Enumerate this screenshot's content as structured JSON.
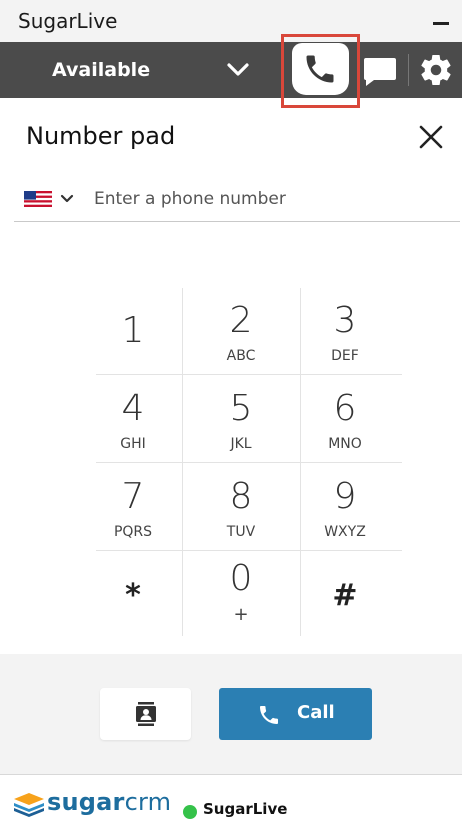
{
  "window": {
    "title": "SugarLive"
  },
  "toolbar": {
    "status": "Available",
    "active_tab": "phone"
  },
  "number_pad": {
    "title": "Number pad",
    "country_flag": "US",
    "phone_placeholder": "Enter a phone number",
    "phone_value": ""
  },
  "keys": [
    {
      "digit": "1",
      "letters": ""
    },
    {
      "digit": "2",
      "letters": "ABC"
    },
    {
      "digit": "3",
      "letters": "DEF"
    },
    {
      "digit": "4",
      "letters": "GHI"
    },
    {
      "digit": "5",
      "letters": "JKL"
    },
    {
      "digit": "6",
      "letters": "MNO"
    },
    {
      "digit": "7",
      "letters": "PQRS"
    },
    {
      "digit": "8",
      "letters": "TUV"
    },
    {
      "digit": "9",
      "letters": "WXYZ"
    },
    {
      "digit": "*",
      "letters": ""
    },
    {
      "digit": "0",
      "letters": "+"
    },
    {
      "digit": "#",
      "letters": ""
    }
  ],
  "actions": {
    "call_label": "Call"
  },
  "footer": {
    "brand_bold": "sugar",
    "brand_thin": "crm",
    "presence_label": "SugarLive"
  },
  "colors": {
    "toolbar_bg": "#4b4b4b",
    "active_tab_highlight": "#d9473a",
    "call_button": "#2b7fb3",
    "presence_online": "#35c24a",
    "brand_blue": "#1d6d9e"
  },
  "icons": {
    "minimize": "minimize-icon",
    "status_dropdown": "chevron-down-icon",
    "phone_tab": "phone-icon",
    "chat_tab": "chat-icon",
    "settings_tab": "gear-icon",
    "close": "close-icon",
    "flag": "us-flag-icon",
    "contacts": "contacts-icon",
    "call": "phone-icon",
    "logo": "sugarcrm-logo-icon"
  }
}
